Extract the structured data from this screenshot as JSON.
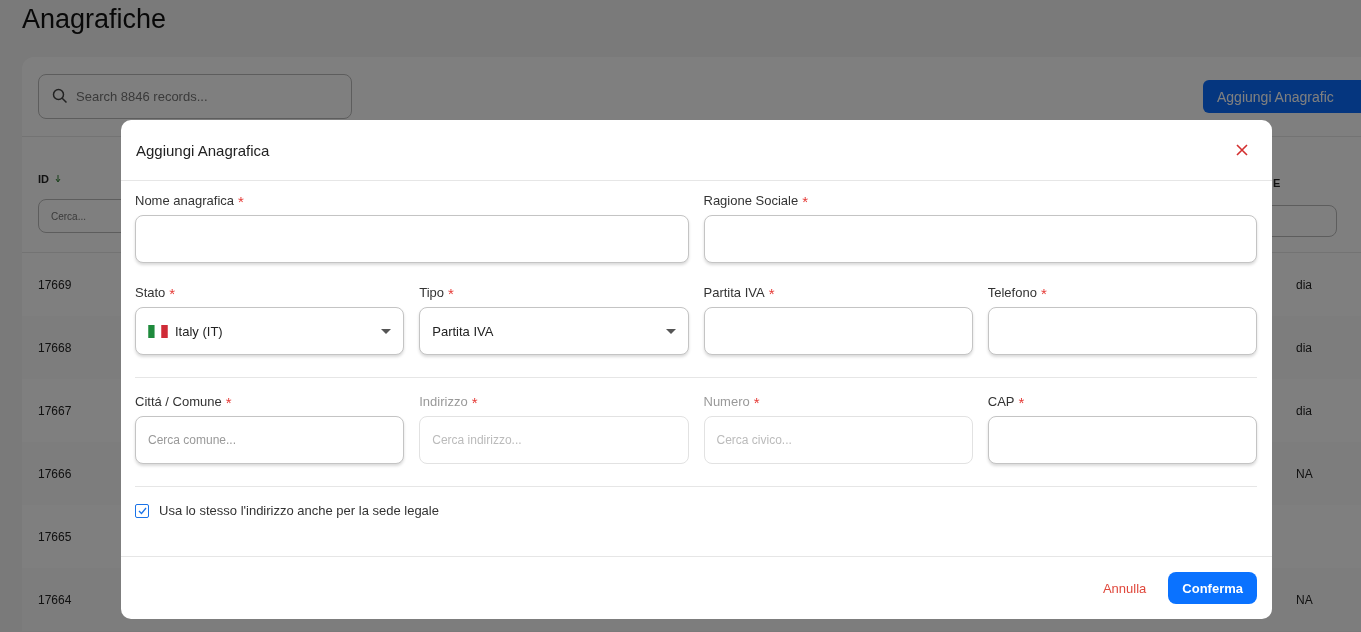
{
  "page": {
    "title": "Anagrafiche"
  },
  "toolbar": {
    "search": {
      "placeholder": "Search 8846 records..."
    },
    "add_button": "Aggiungi Anagrafic"
  },
  "table": {
    "columns": [
      {
        "label": "ID",
        "filter_placeholder": "Cerca..."
      },
      {
        "label": "E"
      }
    ],
    "rows": [
      {
        "id": "17669",
        "column_2": "dia"
      },
      {
        "id": "17668",
        "column_2": "dia"
      },
      {
        "id": "17667",
        "column_2": "dia"
      },
      {
        "id": "17666",
        "column_2": "NA"
      },
      {
        "id": "17665"
      },
      {
        "id": "17664",
        "column_2": "NA"
      }
    ]
  },
  "dialog": {
    "title": "Aggiungi Anagrafica",
    "required_mark": "*",
    "sections": [
      {
        "fields": [
          {
            "label": "Nome anagrafica",
            "kind": "text",
            "required": true,
            "disabled": false
          },
          {
            "label": "Ragione Sociale",
            "kind": "text",
            "required": true,
            "disabled": false
          }
        ]
      },
      {
        "fields": [
          {
            "label": "Stato",
            "kind": "country",
            "required": true,
            "disabled": false,
            "value": "Italy (IT)"
          },
          {
            "label": "Tipo",
            "kind": "select",
            "required": true,
            "disabled": false,
            "value": "Partita IVA"
          },
          {
            "label": "Partita IVA",
            "kind": "text",
            "required": true,
            "disabled": false
          },
          {
            "label": "Telefono",
            "kind": "text",
            "required": true,
            "disabled": false
          }
        ]
      },
      {
        "fields": [
          {
            "label": "Cittá / Comune",
            "kind": "text",
            "required": true,
            "disabled": false,
            "placeholder": "Cerca comune..."
          },
          {
            "label": "Indirizzo",
            "kind": "text",
            "required": true,
            "disabled": true,
            "placeholder": "Cerca indirizzo..."
          },
          {
            "label": "Numero",
            "kind": "text",
            "required": true,
            "disabled": true,
            "placeholder": "Cerca civico..."
          },
          {
            "label": "CAP",
            "kind": "text",
            "required": true,
            "disabled": false
          }
        ]
      }
    ],
    "checkbox": {
      "label": "Usa lo stesso l'indirizzo anche per la sede legale",
      "checked": true
    },
    "buttons": [
      {
        "label": "Annulla",
        "kind": "text"
      },
      {
        "label": "Conferma",
        "kind": "primary"
      }
    ]
  }
}
